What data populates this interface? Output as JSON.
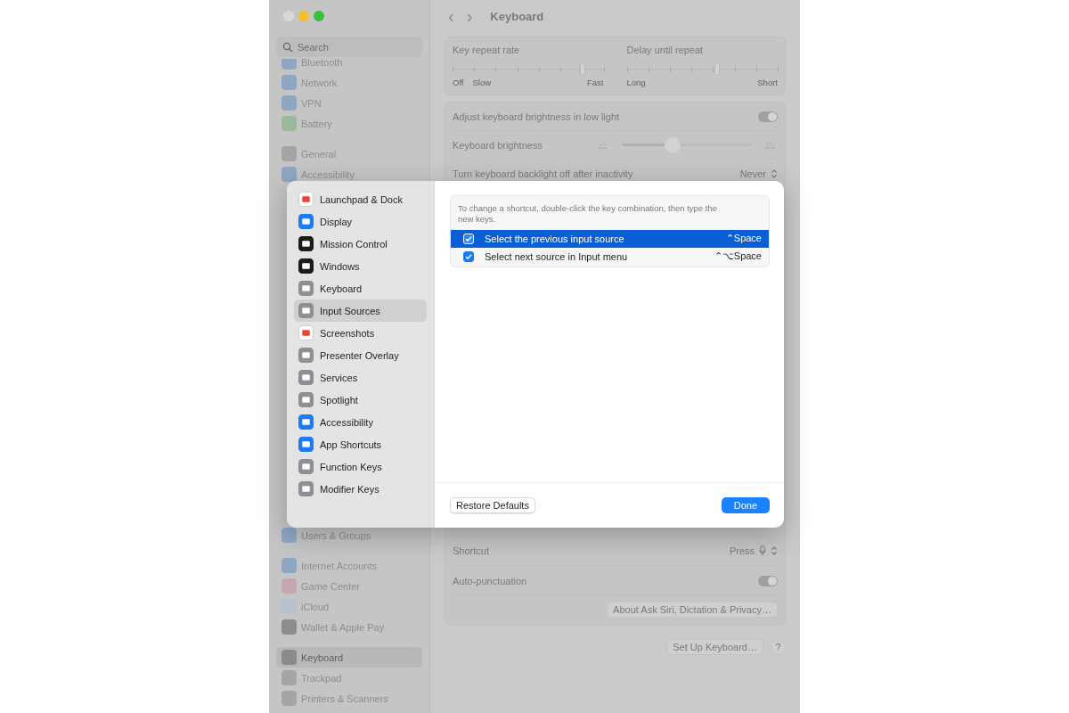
{
  "window": {
    "traffic_lights": [
      {
        "color": "#d9d9d9"
      },
      {
        "color": "#f5bd2f"
      },
      {
        "color": "#37c13e"
      }
    ]
  },
  "sidebar": {
    "search": {
      "placeholder": "Search"
    },
    "groups": [
      [
        {
          "label": "Bluetooth",
          "selected": false,
          "color": "#8fa6c4"
        },
        {
          "label": "Network",
          "selected": false,
          "color": "#8fa6c4"
        },
        {
          "label": "VPN",
          "selected": false,
          "color": "#8fa6c4"
        },
        {
          "label": "Battery",
          "selected": false,
          "color": "#9cb79c"
        }
      ],
      [
        {
          "label": "General",
          "selected": false,
          "color": "#a5a5a5"
        },
        {
          "label": "Accessibility",
          "selected": false,
          "color": "#8fa6c4"
        }
      ],
      [
        {
          "label": "Users & Groups",
          "selected": false,
          "color": "#8fa6c4"
        }
      ],
      [
        {
          "label": "Internet Accounts",
          "selected": false,
          "color": "#8fa6c4"
        },
        {
          "label": "Game Center",
          "selected": false,
          "color": "#c4a7b0"
        },
        {
          "label": "iCloud",
          "selected": false,
          "color": "#b8c2cc"
        },
        {
          "label": "Wallet & Apple Pay",
          "selected": false,
          "color": "#8c8c8c"
        }
      ],
      [
        {
          "label": "Keyboard",
          "selected": true,
          "color": "#8a8a8a"
        },
        {
          "label": "Trackpad",
          "selected": false,
          "color": "#a5a5a5"
        },
        {
          "label": "Printers & Scanners",
          "selected": false,
          "color": "#a5a5a5"
        }
      ]
    ]
  },
  "header": {
    "back": "‹",
    "forward": "›",
    "title": "Keyboard"
  },
  "repeat_card": {
    "sliders": [
      {
        "label": "Key repeat rate",
        "level": 0.86,
        "min_labels": [
          "Off",
          "Slow"
        ],
        "max_label": "Fast"
      },
      {
        "label": "Delay until repeat",
        "level": 0.6,
        "min_labels": [
          "Long"
        ],
        "max_label": "Short"
      }
    ]
  },
  "settings_card": {
    "top_rows": [
      {
        "kind": "toggle",
        "label": "Adjust keyboard brightness in low light",
        "on": true
      },
      {
        "kind": "slider",
        "label": "Keyboard brightness",
        "level": 0.4
      },
      {
        "kind": "popup",
        "label": "Turn keyboard backlight off after inactivity",
        "value": "Never"
      }
    ],
    "bottom_rows": [
      {
        "kind": "mic-popup",
        "label": "Shortcut",
        "value": "Press"
      },
      {
        "kind": "toggle",
        "label": "Auto-punctuation",
        "on": true
      }
    ],
    "button": "About Ask Siri, Dictation & Privacy…"
  },
  "footer": {
    "setup": "Set Up Keyboard…",
    "help": "?"
  },
  "sheet": {
    "categories": [
      {
        "label": "Launchpad & Dock",
        "selected": false,
        "color": "#ffffff"
      },
      {
        "label": "Display",
        "selected": false,
        "color": "#1e7cf2"
      },
      {
        "label": "Mission Control",
        "selected": false,
        "color": "#1c1c1c"
      },
      {
        "label": "Windows",
        "selected": false,
        "color": "#1c1c1c"
      },
      {
        "label": "Keyboard",
        "selected": false,
        "color": "#8e8e93"
      },
      {
        "label": "Input Sources",
        "selected": true,
        "color": "#8e8e93"
      },
      {
        "label": "Screenshots",
        "selected": false,
        "color": "#ffffff"
      },
      {
        "label": "Presenter Overlay",
        "selected": false,
        "color": "#8e8e93"
      },
      {
        "label": "Services",
        "selected": false,
        "color": "#8e8e93"
      },
      {
        "label": "Spotlight",
        "selected": false,
        "color": "#8e8e93"
      },
      {
        "label": "Accessibility",
        "selected": false,
        "color": "#1e7cf2"
      },
      {
        "label": "App Shortcuts",
        "selected": false,
        "color": "#1e7cf2"
      },
      {
        "label": "Function Keys",
        "selected": false,
        "color": "#8e8e93"
      },
      {
        "label": "Modifier Keys",
        "selected": false,
        "color": "#8e8e93"
      }
    ],
    "hint": "To change a shortcut, double-click the key combination, then type the new keys.",
    "shortcuts": [
      {
        "label": "Select the previous input source",
        "keys": "⌃Space",
        "checked": true,
        "selected": true
      },
      {
        "label": "Select next source in Input menu",
        "keys": "⌃⌥Space",
        "checked": true,
        "selected": false
      }
    ],
    "restore": "Restore Defaults",
    "done": "Done"
  }
}
